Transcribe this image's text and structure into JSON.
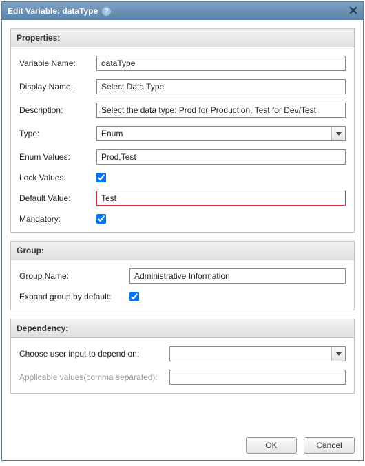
{
  "dialog": {
    "title": "Edit Variable: dataType"
  },
  "properties": {
    "heading": "Properties:",
    "variableName": {
      "label": "Variable Name:",
      "value": "dataType"
    },
    "displayName": {
      "label": "Display Name:",
      "value": "Select Data Type"
    },
    "description": {
      "label": "Description:",
      "value": "Select the data type: Prod for Production, Test for Dev/Test"
    },
    "type": {
      "label": "Type:",
      "value": "Enum"
    },
    "enumValues": {
      "label": "Enum Values:",
      "value": "Prod,Test"
    },
    "lockValues": {
      "label": "Lock Values:",
      "checked": true
    },
    "defaultValue": {
      "label": "Default Value:",
      "value": "Test"
    },
    "mandatory": {
      "label": "Mandatory:",
      "checked": true
    }
  },
  "group": {
    "heading": "Group:",
    "groupName": {
      "label": "Group Name:",
      "value": "Administrative Information"
    },
    "expand": {
      "label": "Expand group by default:",
      "checked": true
    }
  },
  "dependency": {
    "heading": "Dependency:",
    "dependOn": {
      "label": "Choose user input to depend on:",
      "value": ""
    },
    "applicable": {
      "label": "Applicable values(comma separated):",
      "value": ""
    }
  },
  "buttons": {
    "ok": "OK",
    "cancel": "Cancel"
  }
}
